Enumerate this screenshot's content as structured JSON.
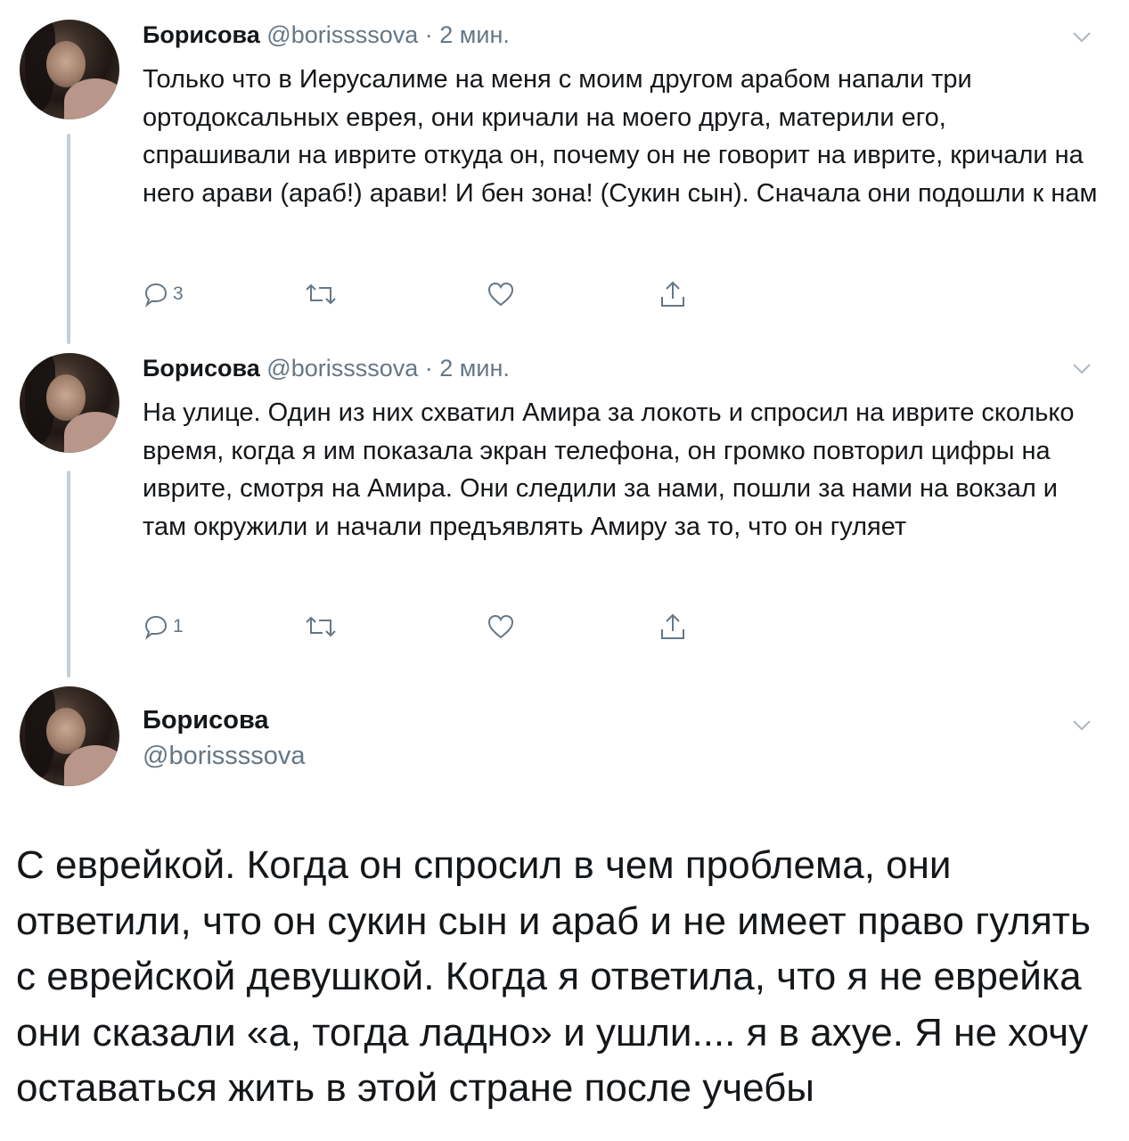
{
  "tweets": [
    {
      "name": "Борисова",
      "handle": "@borissssova",
      "separator": "·",
      "time": "2 мин.",
      "text": "Только что в Иерусалиме на меня с моим другом арабом напали три ортодоксальных еврея, они кричали на моего друга, материли его, спрашивали на иврите откуда он, почему он не говорит на иврите, кричали на него арави (араб!) арави! И бен зона! (Сукин сын). Сначала они подошли к нам",
      "reply_count": "3"
    },
    {
      "name": "Борисова",
      "handle": "@borissssova",
      "separator": "·",
      "time": "2 мин.",
      "text": "На улице. Один из них схватил Амира за локоть и спросил на иврите сколько время, когда я им показала экран телефона, он громко повторил цифры на иврите, смотря на Амира. Они следили за нами, пошли за нами на вокзал и там окружили и начали предъявлять Амиру за то, что он гуляет",
      "reply_count": "1"
    }
  ],
  "main_tweet": {
    "name": "Борисова",
    "handle": "@borissssova",
    "text": "С еврейкой. Когда он спросил в чем проблема, они ответили, что он сукин сын и араб и не имеет право гулять с еврейской девушкой.  Когда я ответила, что я не еврейка они сказали «а, тогда ладно» и ушли.... я в ахуе. Я не хочу оставаться жить в этой стране после учебы"
  },
  "icons": {
    "reply": "reply-icon",
    "retweet": "retweet-icon",
    "like": "heart-icon",
    "share": "share-icon",
    "menu": "chevron-down-icon"
  },
  "colors": {
    "text": "#14171a",
    "secondary": "#657786",
    "thread_line": "#c4cfd6",
    "background": "#ffffff"
  }
}
